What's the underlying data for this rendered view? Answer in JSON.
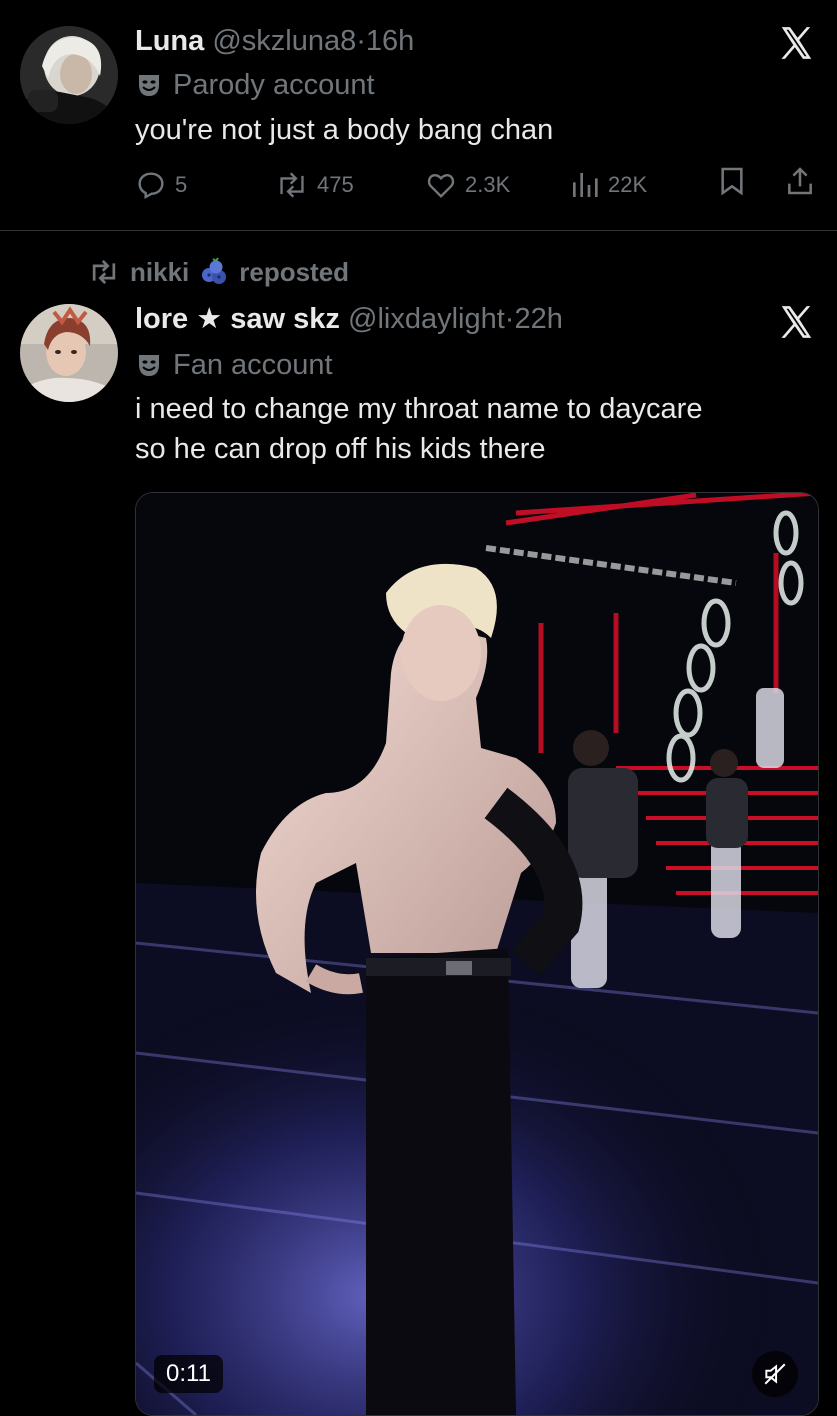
{
  "colors": {
    "background": "#000000",
    "primary_text": "#e7e9ea",
    "secondary_text": "#71767b",
    "divider": "#2f3336",
    "stage_red": "#e0102a"
  },
  "tweets": [
    {
      "display_name": "Luna",
      "handle": "@skzluna8",
      "separator": "·",
      "time": "16h",
      "badge_icon": "theater-mask-icon",
      "badge_label": "Parody account",
      "text": "you're not just a body bang chan",
      "platform_icon": "x-logo-icon",
      "actions": {
        "replies": "5",
        "reposts": "475",
        "likes": "2.3K",
        "views": "22K"
      }
    },
    {
      "repost_by": "nikki",
      "repost_emoji_icon": "blueberries-icon",
      "repost_label": "reposted",
      "display_name": "lore ★ saw skz",
      "handle": "@lixdaylight",
      "separator": "·",
      "time": "22h",
      "badge_icon": "theater-mask-icon",
      "badge_label": "Fan account",
      "text": "i need to change my throat name to daycare\nso he can drop off his kids there",
      "platform_icon": "x-logo-icon",
      "media": {
        "type": "video",
        "duration": "0:11",
        "mute_icon": "speaker-muted-icon"
      }
    }
  ]
}
